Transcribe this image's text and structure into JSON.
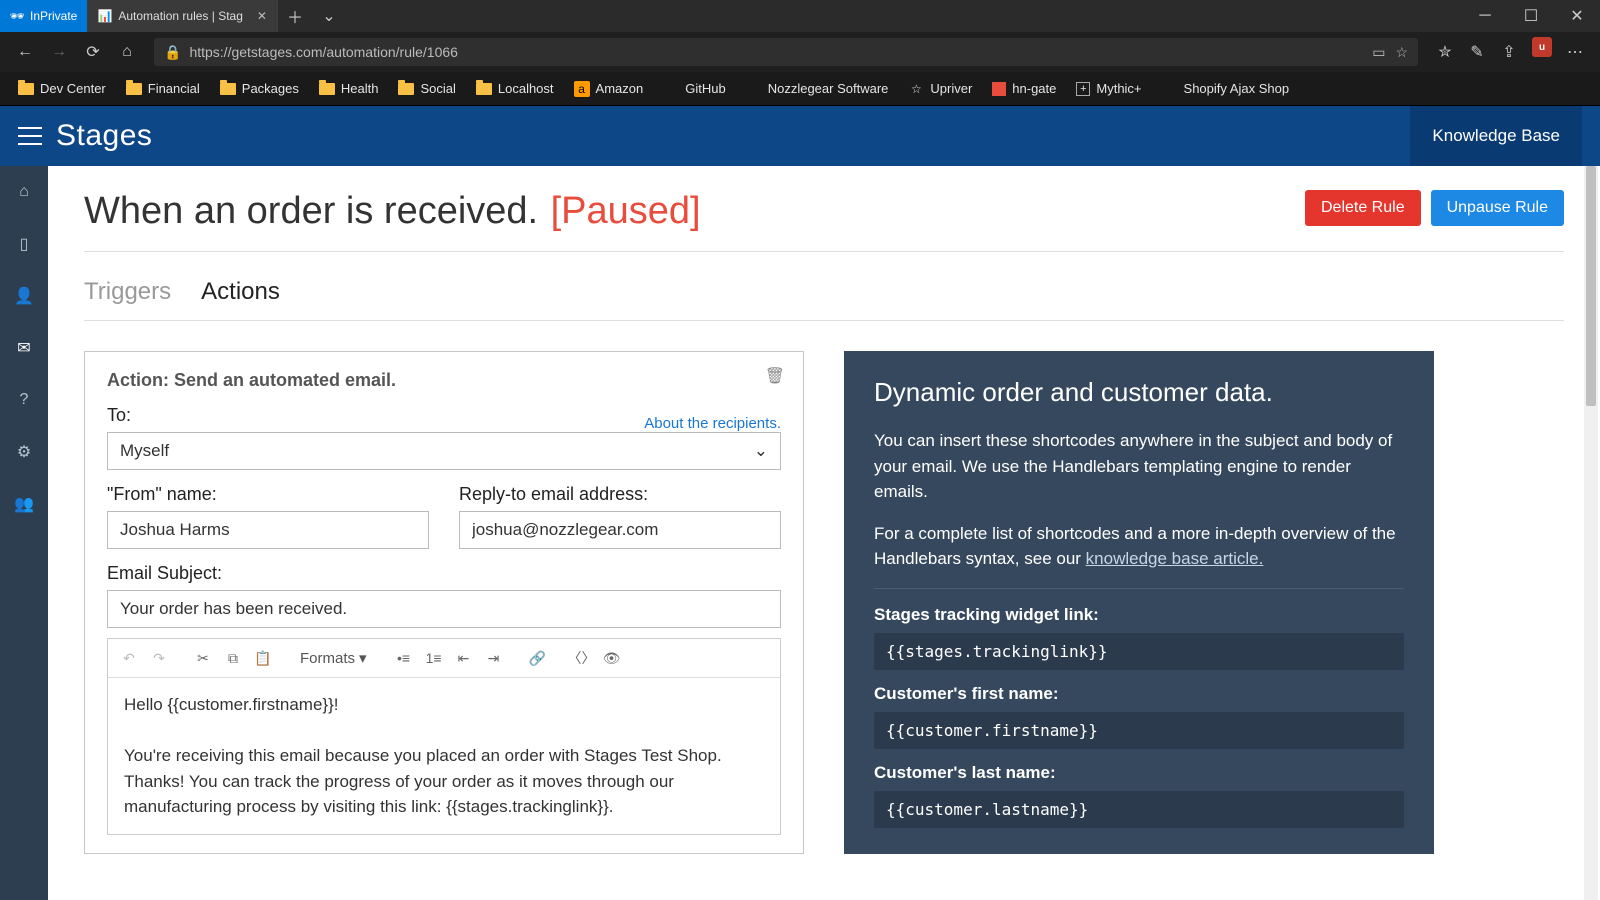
{
  "browser": {
    "inprivate_label": "InPrivate",
    "tab_title": "Automation rules | Stag",
    "url": "https://getstages.com/automation/rule/1066",
    "bookmarks": [
      "Dev Center",
      "Financial",
      "Packages",
      "Health",
      "Social",
      "Localhost",
      "Amazon",
      "GitHub",
      "Nozzlegear Software",
      "Upriver",
      "hn-gate",
      "Mythic+",
      "Shopify Ajax Shop"
    ]
  },
  "header": {
    "brand": "Stages",
    "knowledge_base": "Knowledge Base"
  },
  "page": {
    "title": "When an order is received.",
    "status": "[Paused]",
    "delete_btn": "Delete Rule",
    "unpause_btn": "Unpause Rule"
  },
  "tabs": {
    "triggers": "Triggers",
    "actions": "Actions"
  },
  "action": {
    "card_title": "Action: Send an automated email.",
    "to_label": "To:",
    "about_recipients": "About the recipients.",
    "to_value": "Myself",
    "from_label": "\"From\" name:",
    "from_value": "Joshua Harms",
    "reply_label": "Reply-to email address:",
    "reply_value": "joshua@nozzlegear.com",
    "subject_label": "Email Subject:",
    "subject_value": "Your order has been received.",
    "formats_label": "Formats",
    "body_line1": "Hello {{customer.firstname}}!",
    "body_line2": "You're receiving this email because you placed an order with Stages Test Shop. Thanks! You can track the progress of your order as it moves through our manufacturing process by visiting this link: {{stages.trackinglink}}."
  },
  "info": {
    "title": "Dynamic order and customer data.",
    "p1": "You can insert these shortcodes anywhere in the subject and body of your email. We use the Handlebars templating engine to render emails.",
    "p2a": "For a complete list of shortcodes and a more in-depth overview of the Handlebars syntax, see our ",
    "p2link": "knowledge base article.",
    "s1_label": "Stages tracking widget link:",
    "s1_code": "{{stages.trackinglink}}",
    "s2_label": "Customer's first name:",
    "s2_code": "{{customer.firstname}}",
    "s3_label": "Customer's last name:",
    "s3_code": "{{customer.lastname}}"
  }
}
